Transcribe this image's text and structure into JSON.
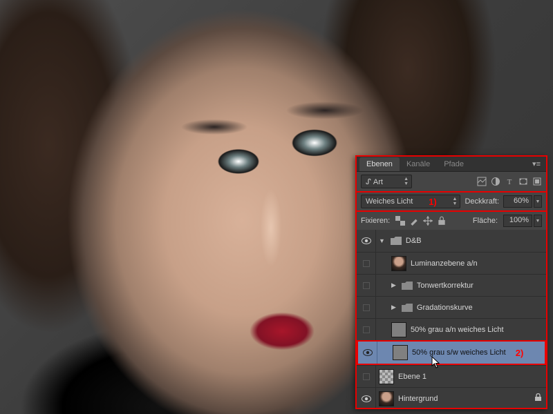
{
  "tabs": {
    "layers": "Ebenen",
    "channels": "Kanäle",
    "paths": "Pfade"
  },
  "filter": {
    "type_label_prefix": "ᔑ",
    "type_label": "Art"
  },
  "blend": {
    "mode": "Weiches Licht",
    "annotation": "1)",
    "opacity_label": "Deckkraft:",
    "opacity_value": "60%"
  },
  "lock": {
    "label": "Fixieren:",
    "fill_label": "Fläche:",
    "fill_value": "100%"
  },
  "layers": [
    {
      "name": "D&B"
    },
    {
      "name": "Luminanzebene a/n"
    },
    {
      "name": "Tonwertkorrektur"
    },
    {
      "name": "Gradationskurve"
    },
    {
      "name": "50% grau a/n weiches Licht"
    },
    {
      "name": "50% grau s/w weiches Licht",
      "annotation": "2)"
    },
    {
      "name": "Ebene 1"
    },
    {
      "name": "Hintergrund"
    }
  ]
}
